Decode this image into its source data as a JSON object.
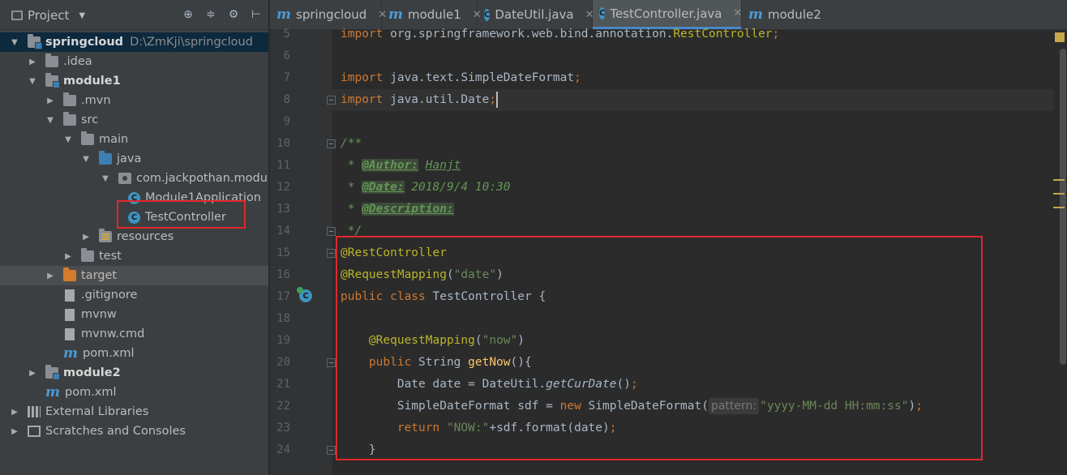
{
  "project_panel": {
    "title": "Project",
    "tree": [
      {
        "label": "springcloud",
        "extra": "D:\\ZmKji\\springcloud"
      },
      {
        "label": ".idea"
      },
      {
        "label": "module1"
      },
      {
        "label": ".mvn"
      },
      {
        "label": "src"
      },
      {
        "label": "main"
      },
      {
        "label": "java"
      },
      {
        "label": "com.jackpothan.module"
      },
      {
        "label": "Module1Application"
      },
      {
        "label": "TestController"
      },
      {
        "label": "resources"
      },
      {
        "label": "test"
      },
      {
        "label": "target"
      },
      {
        "label": ".gitignore"
      },
      {
        "label": "mvnw"
      },
      {
        "label": "mvnw.cmd"
      },
      {
        "label": "pom.xml"
      },
      {
        "label": "module2"
      },
      {
        "label": "pom.xml"
      },
      {
        "label": "External Libraries"
      },
      {
        "label": "Scratches and Consoles"
      }
    ]
  },
  "tabs": [
    {
      "label": "springcloud"
    },
    {
      "label": "module1"
    },
    {
      "label": "DateUtil.java"
    },
    {
      "label": "TestController.java"
    },
    {
      "label": "module2"
    }
  ],
  "editor": {
    "lines": [
      {
        "n": "5",
        "parts": [
          [
            "kw",
            "import "
          ],
          [
            "",
            "org.springframework.web.bind.annotation."
          ],
          [
            "ann",
            "RestController"
          ],
          [
            "kw",
            ";"
          ]
        ]
      },
      {
        "n": "6",
        "parts": []
      },
      {
        "n": "7",
        "parts": [
          [
            "kw",
            "import "
          ],
          [
            "",
            "java.text.SimpleDateFormat"
          ],
          [
            "kw",
            ";"
          ]
        ]
      },
      {
        "n": "8",
        "parts": [
          [
            "kw",
            "import "
          ],
          [
            "",
            "java.util.Date"
          ],
          [
            "kw",
            ";"
          ]
        ]
      },
      {
        "n": "9",
        "parts": []
      },
      {
        "n": "10",
        "parts": [
          [
            "doc",
            "/**"
          ]
        ]
      },
      {
        "n": "11",
        "parts": [
          [
            "doc",
            " * "
          ],
          [
            "doctag",
            "@Author:"
          ],
          [
            "doc",
            " "
          ],
          [
            "docu",
            "Hanjt"
          ]
        ]
      },
      {
        "n": "12",
        "parts": [
          [
            "doc",
            " * "
          ],
          [
            "doctag",
            "@Date:"
          ],
          [
            "doc",
            " 2018/9/4 10:30"
          ]
        ]
      },
      {
        "n": "13",
        "parts": [
          [
            "doc",
            " * "
          ],
          [
            "doctag",
            "@Description:"
          ]
        ]
      },
      {
        "n": "14",
        "parts": [
          [
            "doc",
            " */"
          ]
        ]
      },
      {
        "n": "15",
        "parts": [
          [
            "ann",
            "@RestController"
          ]
        ]
      },
      {
        "n": "16",
        "parts": [
          [
            "ann",
            "@RequestMapping"
          ],
          [
            "",
            "("
          ],
          [
            "str",
            "\"date\""
          ],
          [
            "",
            ")"
          ]
        ]
      },
      {
        "n": "17",
        "parts": [
          [
            "kw",
            "public class "
          ],
          [
            "",
            "TestController {"
          ]
        ]
      },
      {
        "n": "18",
        "parts": []
      },
      {
        "n": "19",
        "parts": [
          [
            "",
            "    "
          ],
          [
            "ann",
            "@RequestMapping"
          ],
          [
            "",
            "("
          ],
          [
            "str",
            "\"now\""
          ],
          [
            "",
            ")"
          ]
        ]
      },
      {
        "n": "20",
        "parts": [
          [
            "",
            "    "
          ],
          [
            "kw",
            "public "
          ],
          [
            "",
            "String "
          ],
          [
            "fn",
            "getNow"
          ],
          [
            "",
            "(){"
          ]
        ]
      },
      {
        "n": "21",
        "parts": [
          [
            "",
            "        Date date = DateUtil."
          ],
          [
            "it",
            "getCurDate"
          ],
          [
            "",
            "()"
          ],
          [
            "kw",
            ";"
          ]
        ]
      },
      {
        "n": "22",
        "parts": [
          [
            "",
            "        SimpleDateFormat sdf = "
          ],
          [
            "kw",
            "new "
          ],
          [
            "",
            "SimpleDateFormat("
          ],
          [
            "hint",
            "pattern:"
          ],
          [
            "str",
            "\"yyyy-MM-dd HH:mm:ss\""
          ],
          [
            "",
            ")"
          ],
          [
            "kw",
            ";"
          ]
        ]
      },
      {
        "n": "23",
        "parts": [
          [
            "",
            "        "
          ],
          [
            "kw",
            "return "
          ],
          [
            "str",
            "\"NOW:\""
          ],
          [
            "",
            "+sdf.format(date)"
          ],
          [
            "kw",
            ";"
          ]
        ]
      },
      {
        "n": "24",
        "parts": [
          [
            "",
            "    }"
          ]
        ]
      }
    ]
  }
}
